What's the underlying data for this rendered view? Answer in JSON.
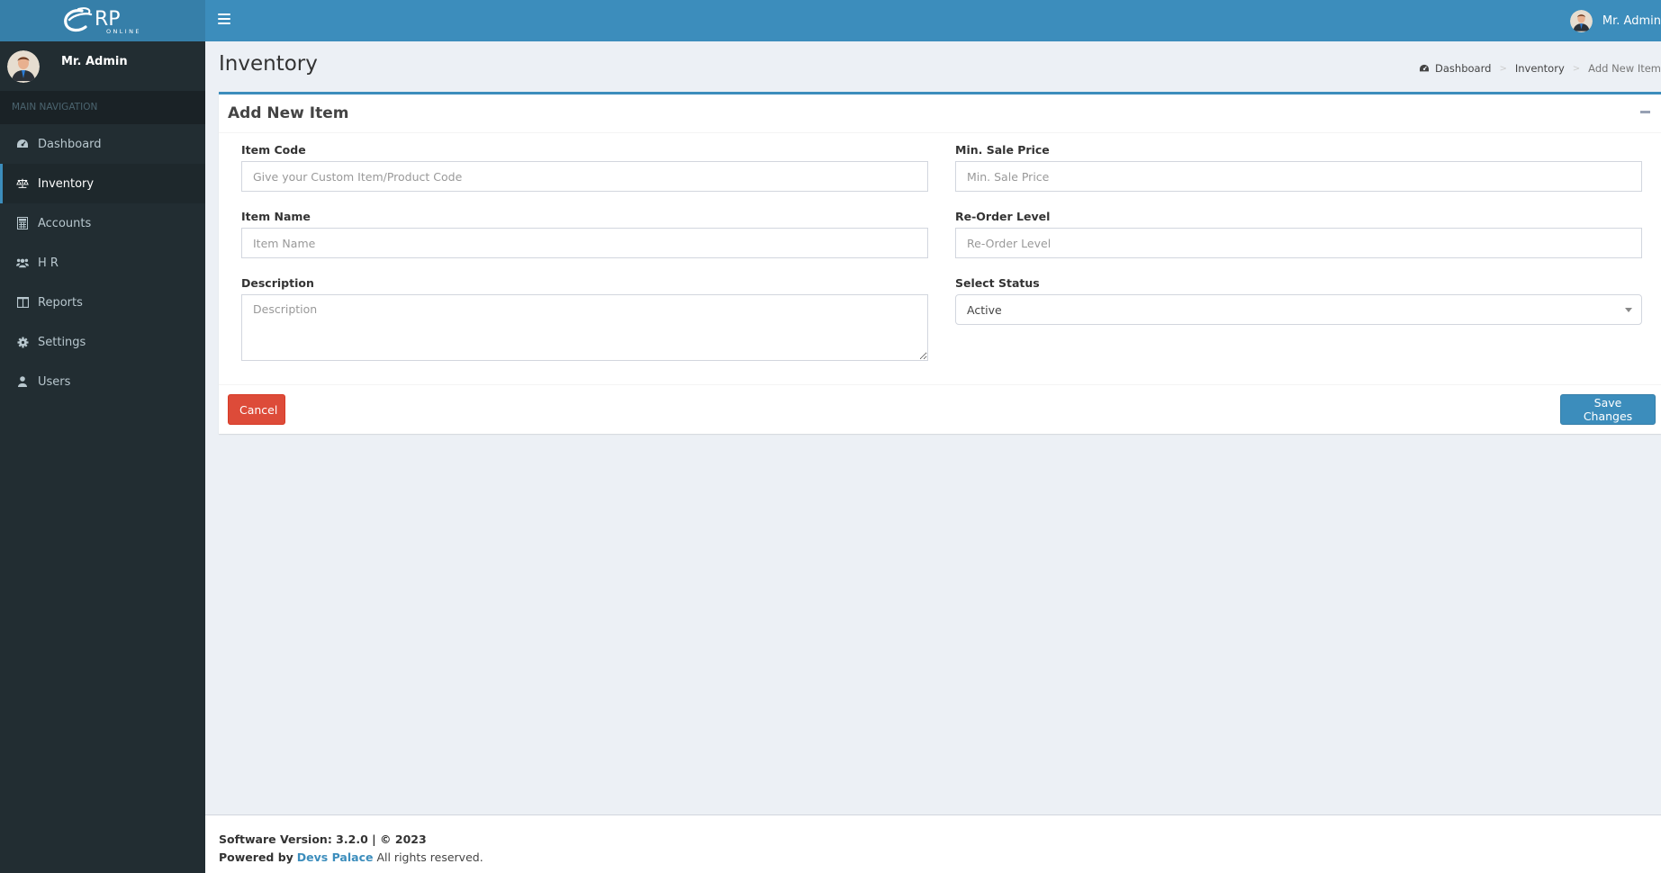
{
  "app": {
    "logo_text": "RP",
    "logo_subtext": "ONLINE",
    "brand_color": "#3c8dbc",
    "logo_bg": "#367fa9"
  },
  "navbar": {
    "toggle_icon": "hamburger-icon",
    "user_name": "Mr. Admin"
  },
  "sidebar": {
    "user_name": "Mr. Admin",
    "section_header": "MAIN NAVIGATION",
    "items": [
      {
        "label": "Dashboard",
        "icon": "dashboard-icon",
        "active": false
      },
      {
        "label": "Inventory",
        "icon": "balance-scale-icon",
        "active": true
      },
      {
        "label": "Accounts",
        "icon": "calculator-icon",
        "active": false
      },
      {
        "label": "H R",
        "icon": "users-group-icon",
        "active": false
      },
      {
        "label": "Reports",
        "icon": "columns-icon",
        "active": false
      },
      {
        "label": "Settings",
        "icon": "gear-icon",
        "active": false
      },
      {
        "label": "Users",
        "icon": "user-icon",
        "active": false
      }
    ]
  },
  "page": {
    "title": "Inventory",
    "breadcrumb": [
      {
        "label": "Dashboard",
        "icon": "dashboard-icon"
      },
      {
        "label": "Inventory"
      },
      {
        "label": "Add New Item"
      }
    ],
    "breadcrumb_separator": ">"
  },
  "form": {
    "title": "Add New Item",
    "fields": {
      "item_code": {
        "label": "Item Code",
        "placeholder": "Give your Custom Item/Product Code",
        "value": ""
      },
      "item_name": {
        "label": "Item Name",
        "placeholder": "Item Name",
        "value": ""
      },
      "description": {
        "label": "Description",
        "placeholder": "Description",
        "value": ""
      },
      "min_sale_price": {
        "label": "Min. Sale Price",
        "placeholder": "Min. Sale Price",
        "value": ""
      },
      "reorder_level": {
        "label": "Re-Order Level",
        "placeholder": "Re-Order Level",
        "value": ""
      },
      "status": {
        "label": "Select Status",
        "selected": "Active"
      }
    },
    "cancel_label": "Cancel",
    "save_label": "Save Changes",
    "cancel_color": "#dd4b39",
    "save_color": "#3c8dbc"
  },
  "footer": {
    "version_text": "Software Version: 3.2.0 | © 2023",
    "powered_by": "Powered by",
    "company": "Devs Palace",
    "rights": "All rights reserved."
  }
}
